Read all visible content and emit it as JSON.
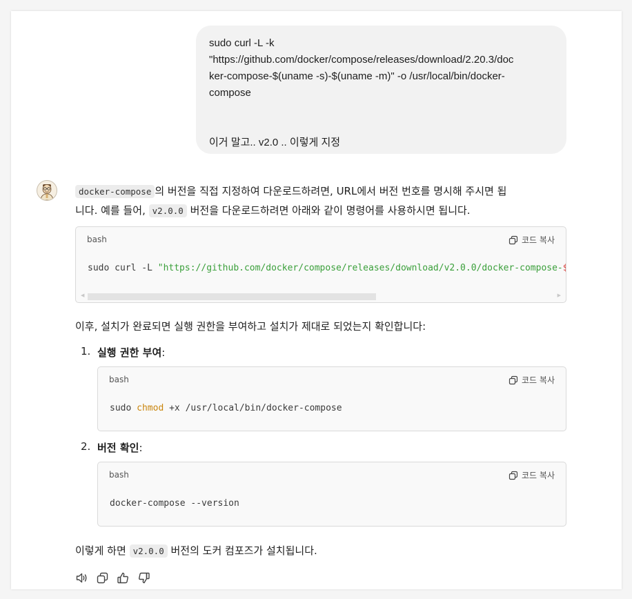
{
  "user_message": {
    "lines": [
      "sudo curl -L -k",
      "\"https://github.com/docker/compose/releases/download/2.20.3/doc",
      "ker-compose-$(uname -s)-$(uname -m)\" -o /usr/local/bin/docker-",
      "compose"
    ],
    "last_line": "이거 말고..  v2.0 ..    이렇게 지정"
  },
  "assistant": {
    "intro": {
      "code_term": "docker-compose",
      "line1_rest": "의 버전을 직접 지정하여 다운로드하려면, URL에서 버전 번호를 명시해 주시면 됩",
      "line2_pre": "니다. 예를 들어,",
      "version": "v2.0.0",
      "line2_post": "버전을 다운로드하려면 아래와 같이 명령어를 사용하시면 됩니다."
    },
    "code1": {
      "lang": "bash",
      "copy_label": "코드 복사",
      "plain": "sudo curl -L ",
      "string": "\"https://github.com/docker/compose/releases/download/v2.0.0/docker-compose-",
      "red": "$("
    },
    "after_text": "이후, 설치가 완료되면 실행 권한을 부여하고 설치가 제대로 되었는지 확인합니다:",
    "step1": {
      "num": "1.",
      "title": "실행 권한 부여",
      "colon": ":",
      "lang": "bash",
      "copy_label": "코드 복사",
      "code_pre": "sudo ",
      "code_kw": "chmod",
      "code_post": " +x /usr/local/bin/docker-compose"
    },
    "step2": {
      "num": "2.",
      "title": "버전 확인",
      "colon": ":",
      "lang": "bash",
      "copy_label": "코드 복사",
      "code": "docker-compose --version"
    },
    "outro": {
      "pre": "이렇게 하면",
      "version": "v2.0.0",
      "post": "버전의 도커 컴포즈가 설치됩니다."
    }
  },
  "icons": {
    "avatar": "cartoon-avatar-icon",
    "copy": "copy-icon",
    "actions": [
      "speaker-icon",
      "copy-icon",
      "thumbs-up-icon",
      "thumbs-down-icon"
    ]
  },
  "colors": {
    "string": "#3a9f3a",
    "keyword": "#c9850d",
    "interp": "#d9403a",
    "bubble": "#f2f2f2"
  }
}
